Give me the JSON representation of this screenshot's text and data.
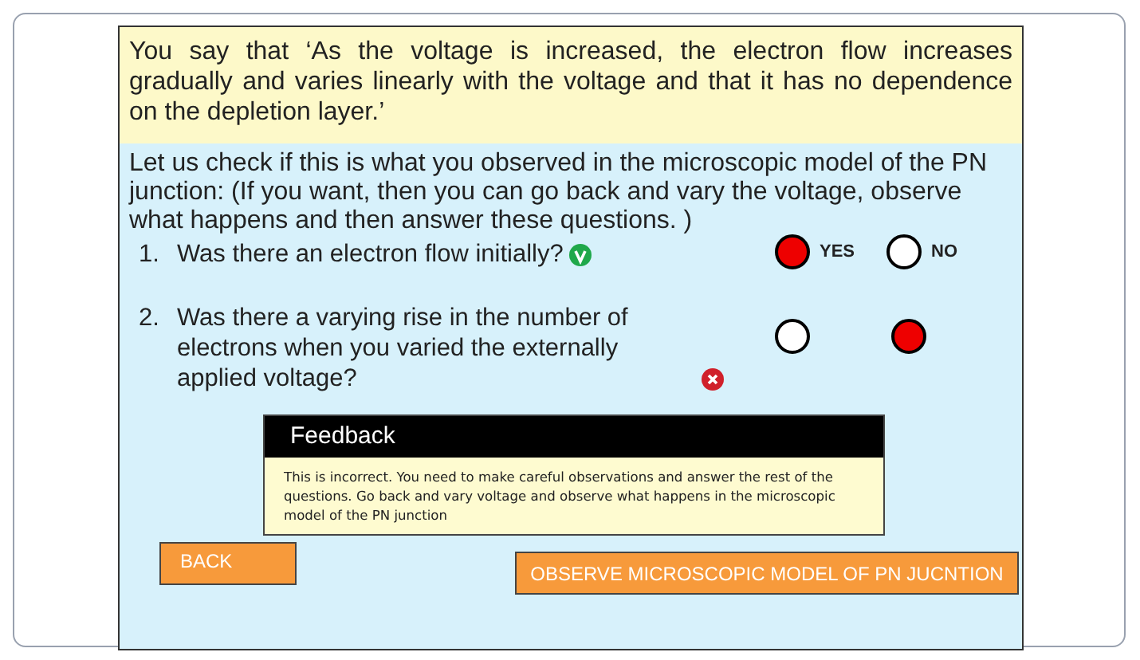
{
  "statement": "You say that ‘As the voltage is increased, the electron flow increases gradually and varies linearly with the voltage and that it has no dependence on the depletion layer.’",
  "instructions": "Let us check if this is what you observed in the microscopic model of the PN junction: (If you want, then you can go back and vary the voltage, observe what happens and then answer these questions. )",
  "questions": [
    {
      "number": "1.",
      "text": "Was there an electron flow initially?",
      "kind": "correct",
      "options": [
        {
          "label": "YES",
          "selected": true
        },
        {
          "label": "NO",
          "selected": false
        }
      ]
    },
    {
      "number": "2.",
      "text": "Was there a varying rise in the number of electrons when you varied the externally applied voltage?",
      "kind": "incorrect",
      "options": [
        {
          "selected": false
        },
        {
          "selected": true
        }
      ]
    }
  ],
  "feedback": {
    "title": "Feedback",
    "text": "This is incorrect. You need to make careful observations and answer the rest of the questions. Go back and vary voltage and observe what happens in the microscopic model of the PN junction"
  },
  "buttons": {
    "back": "BACK",
    "observe": "OBSERVE MICROSCOPIC  MODEL OF PN JUCNTION"
  }
}
